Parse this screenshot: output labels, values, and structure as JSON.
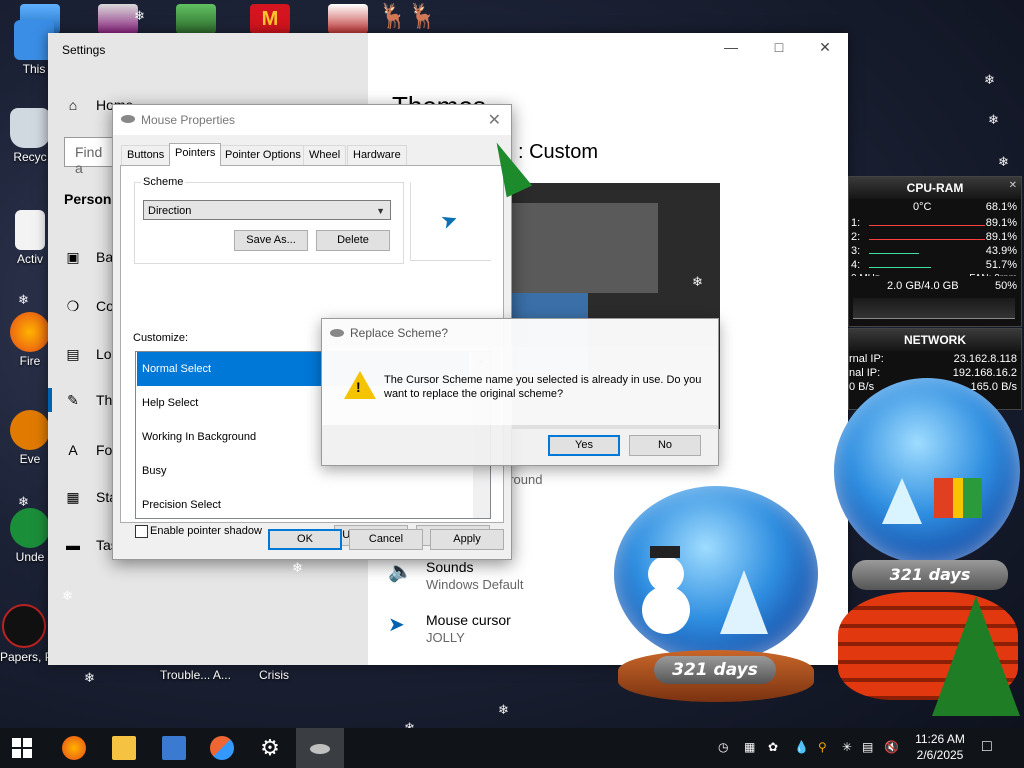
{
  "desktop": {
    "icons": [
      {
        "label": "This"
      },
      {
        "label": "Recyc"
      },
      {
        "label": "Activ"
      },
      {
        "label": "Fire"
      },
      {
        "label": "Eve"
      },
      {
        "label": "Unde"
      },
      {
        "label": "Papers, P"
      }
    ],
    "bottom_labels": [
      "Trouble... A...",
      "Crisis"
    ]
  },
  "settings": {
    "window_title": "Settings",
    "nav": {
      "home": "Home",
      "search_placeholder": "Find a",
      "section": "Persona",
      "items": [
        "Ba",
        "Co",
        "Lo",
        "The",
        "Fo",
        "Sta",
        "Tas"
      ]
    },
    "main": {
      "title": "Themes",
      "current_theme": ": Custom",
      "background_value": "ground",
      "sounds_label": "Sounds",
      "sounds_value": "Windows Default",
      "cursor_label": "Mouse cursor",
      "cursor_value": "JOLLY"
    }
  },
  "mouse_properties": {
    "title": "Mouse Properties",
    "tabs": [
      "Buttons",
      "Pointers",
      "Pointer Options",
      "Wheel",
      "Hardware"
    ],
    "active_tab": "Pointers",
    "scheme_label": "Scheme",
    "scheme_value": "Direction",
    "save_as": "Save As...",
    "delete": "Delete",
    "customize_label": "Customize:",
    "pointers": [
      "Normal Select",
      "Help Select",
      "Working In Background",
      "Busy",
      "Precision Select"
    ],
    "selected_pointer": "Normal Select",
    "shadow_label": "Enable pointer shadow",
    "use_default": "Use Default",
    "browse": "Browse...",
    "ok": "OK",
    "cancel": "Cancel",
    "apply": "Apply"
  },
  "replace_dialog": {
    "title": "Replace Scheme?",
    "message": "The Cursor Scheme name you selected is already in use.  Do you want to replace the original scheme?",
    "yes": "Yes",
    "no": "No"
  },
  "cpu_gadget": {
    "title": "CPU-RAM",
    "temp": "0°C",
    "total": "68.1%",
    "cores": [
      {
        "label": "1:",
        "value": "89.1%",
        "color": "#ff4040"
      },
      {
        "label": "2:",
        "value": "89.1%",
        "color": "#ff4040"
      },
      {
        "label": "3:",
        "value": "43.9%",
        "color": "#40e0a0"
      },
      {
        "label": "4:",
        "value": "51.7%",
        "color": "#40e0a0"
      }
    ],
    "freq": "0 MHz",
    "fan": "FAN: 0rpm",
    "ram": "2.0 GB/4.0 GB",
    "ram_pct": "50%"
  },
  "network_gadget": {
    "title": "NETWORK",
    "external_label": "rnal IP:",
    "external_ip": "23.162.8.118",
    "internal_label": "nal IP:",
    "internal_ip": "192.168.16.2",
    "up_label": "0 B/s",
    "down_value": "165.0 B/s"
  },
  "globes": {
    "left_days": "321 days",
    "right_days": "321 days"
  },
  "taskbar": {
    "time": "11:26 AM",
    "date": "2/6/2025"
  },
  "colors": {
    "accent": "#0078d7",
    "selection": "#0078d7",
    "settings_nav_bg": "#e6e6e6"
  }
}
